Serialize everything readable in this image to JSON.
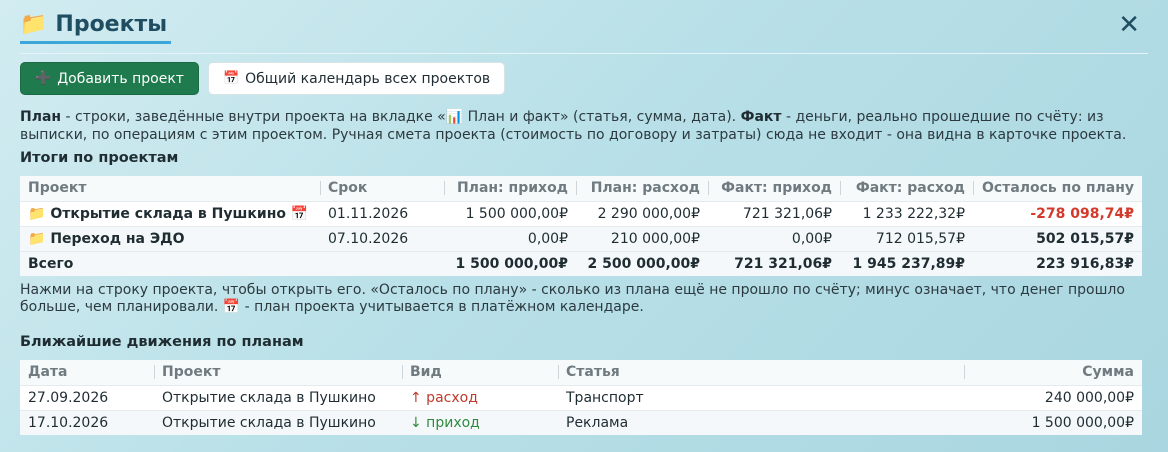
{
  "header": {
    "icon": "📁",
    "title": "Проекты",
    "close": "✕"
  },
  "buttons": {
    "add_icon": "➕",
    "add_label": "Добавить проект",
    "calendar_icon": "📅",
    "calendar_label": "Общий календарь всех проектов"
  },
  "description": {
    "plan_term": "План",
    "plan_text": " - строки, заведённые внутри проекта на вкладке «📊 План и факт» (статья, сумма, дата). ",
    "fact_term": "Факт",
    "fact_text": " - деньги, реально прошедшие по счёту: из выписки, по операциям с этим проектом. Ручная смета проекта (стоимость по договору и затраты) сюда не входит - она видна в карточке проекта."
  },
  "projects_section": {
    "title": "Итоги по проектам",
    "columns": [
      "Проект",
      "Срок",
      "План: приход",
      "План: расход",
      "Факт: приход",
      "Факт: расход",
      "Осталось по плану"
    ],
    "rows": [
      {
        "icon": "📁",
        "name": "Открытие склада в Пушкино",
        "cal_icon": "📅",
        "deadline": "01.11.2026",
        "plan_in": "1 500 000,00₽",
        "plan_out": "2 290 000,00₽",
        "fact_in": "721 321,06₽",
        "fact_out": "1 233 222,32₽",
        "remaining": "-278 098,74₽"
      },
      {
        "icon": "📁",
        "name": "Переход на ЭДО",
        "cal_icon": "",
        "deadline": "07.10.2026",
        "plan_in": "0,00₽",
        "plan_out": "210 000,00₽",
        "fact_in": "0,00₽",
        "fact_out": "712 015,57₽",
        "remaining": "502 015,57₽"
      }
    ],
    "total": {
      "label": "Всего",
      "plan_in": "1 500 000,00₽",
      "plan_out": "2 500 000,00₽",
      "fact_in": "721 321,06₽",
      "fact_out": "1 945 237,89₽",
      "remaining": "223 916,83₽"
    },
    "note": "Нажми на строку проекта, чтобы открыть его. «Осталось по плану» - сколько из плана ещё не прошло по счёту; минус означает, что денег прошло больше, чем планировали. 📅 - план проекта учитывается в платёжном календаре."
  },
  "movements_section": {
    "title": "Ближайшие движения по планам",
    "columns": [
      "Дата",
      "Проект",
      "Вид",
      "Статья",
      "Сумма"
    ],
    "rows": [
      {
        "date": "27.09.2026",
        "project": "Открытие склада в Пушкино",
        "kind": "↑ расход",
        "item": "Транспорт",
        "sum": "240 000,00₽"
      },
      {
        "date": "17.10.2026",
        "project": "Открытие склада в Пушкино",
        "kind": "↓ приход",
        "item": "Реклама",
        "sum": "1 500 000,00₽"
      }
    ]
  },
  "colors": {
    "primary_button": "#1f7a4d",
    "negative": "#d33a2c",
    "expense": "#c0392b",
    "income": "#2e8b3e",
    "accent_underline": "#3aa7d8"
  }
}
